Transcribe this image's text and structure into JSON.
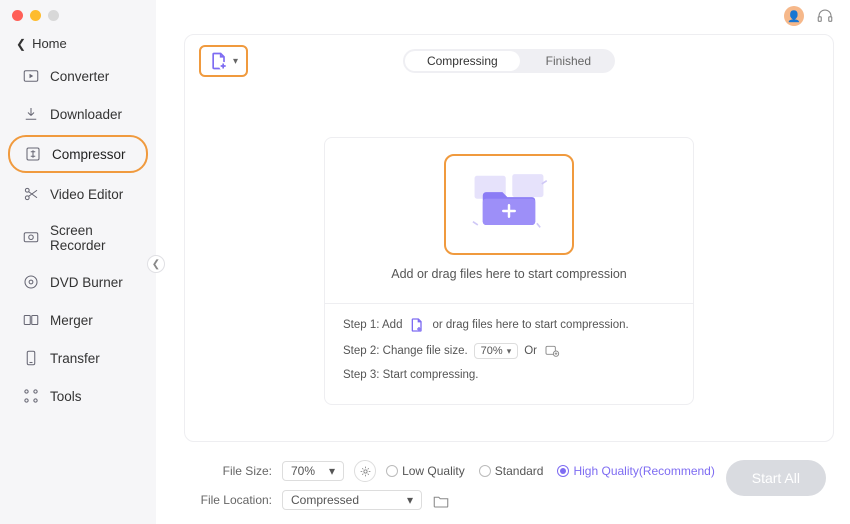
{
  "home_label": "Home",
  "sidebar": {
    "items": [
      {
        "label": "Converter"
      },
      {
        "label": "Downloader"
      },
      {
        "label": "Compressor"
      },
      {
        "label": "Video Editor"
      },
      {
        "label": "Screen Recorder"
      },
      {
        "label": "DVD Burner"
      },
      {
        "label": "Merger"
      },
      {
        "label": "Transfer"
      },
      {
        "label": "Tools"
      }
    ]
  },
  "tabs": {
    "compressing": "Compressing",
    "finished": "Finished"
  },
  "drop": {
    "text": "Add or drag files here to start compression",
    "step1_prefix": "Step 1: Add",
    "step1_suffix": "or drag files here to start compression.",
    "step2_prefix": "Step 2: Change file size.",
    "step2_value": "70%",
    "step2_or": "Or",
    "step3": "Step 3: Start compressing."
  },
  "footer": {
    "filesize_label": "File Size:",
    "filesize_value": "70%",
    "fileloc_label": "File Location:",
    "fileloc_value": "Compressed",
    "quality": {
      "low": "Low Quality",
      "standard": "Standard",
      "high": "High Quality(Recommend)"
    },
    "start_label": "Start All"
  },
  "colors": {
    "accent": "#7e6cf2",
    "highlight": "#f09a3e"
  }
}
